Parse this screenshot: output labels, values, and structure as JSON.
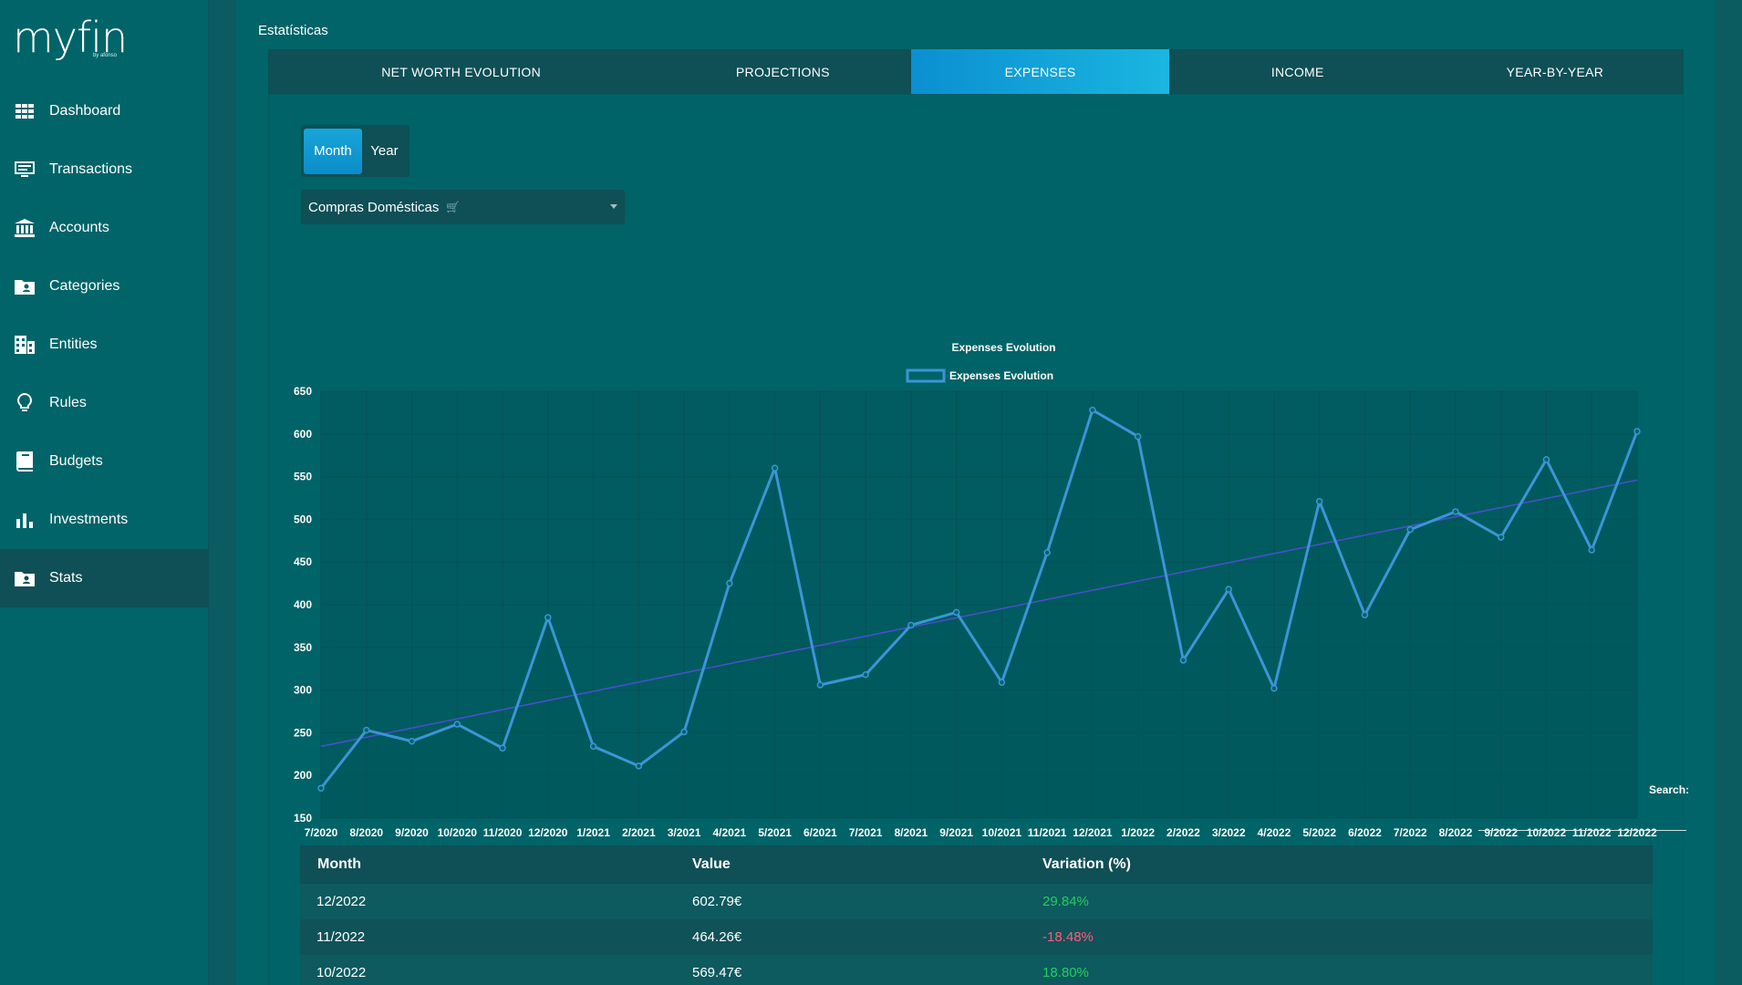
{
  "app": {
    "logo_text": "myfin",
    "logo_sub": "by afonso"
  },
  "sidebar": {
    "items": [
      {
        "label": "Dashboard",
        "icon": "grid-icon"
      },
      {
        "label": "Transactions",
        "icon": "monitor-icon"
      },
      {
        "label": "Accounts",
        "icon": "bank-icon"
      },
      {
        "label": "Categories",
        "icon": "folder-user-icon"
      },
      {
        "label": "Entities",
        "icon": "building-icon"
      },
      {
        "label": "Rules",
        "icon": "lightbulb-icon"
      },
      {
        "label": "Budgets",
        "icon": "book-icon"
      },
      {
        "label": "Investments",
        "icon": "bar-chart-icon"
      },
      {
        "label": "Stats",
        "icon": "folder-user-icon"
      }
    ],
    "active": "Stats"
  },
  "page": {
    "title": "Estatísticas"
  },
  "tabs": [
    "NET WORTH EVOLUTION",
    "PROJECTIONS",
    "EXPENSES",
    "INCOME",
    "YEAR-BY-YEAR"
  ],
  "active_tab": "EXPENSES",
  "toggle": {
    "month": "Month",
    "year": "Year",
    "selected": "Month"
  },
  "category_select": {
    "value": "Compras Domésticas",
    "emoji": "🛒"
  },
  "search": {
    "label": "Search:",
    "value": ""
  },
  "colors": {
    "accent": "#1ab6e0",
    "line": "#3b95d6",
    "trend": "#4a4fd0",
    "positive": "#22d05a",
    "negative": "#ff5c7a"
  },
  "chart_data": {
    "type": "line",
    "title": "Expenses Evolution",
    "legend": [
      "Expenses Evolution"
    ],
    "legend_position": "top",
    "grid": true,
    "ylim": [
      150,
      650
    ],
    "yticks": [
      150,
      200,
      250,
      300,
      350,
      400,
      450,
      500,
      550,
      600,
      650
    ],
    "categories": [
      "7/2020",
      "8/2020",
      "9/2020",
      "10/2020",
      "11/2020",
      "12/2020",
      "1/2021",
      "2/2021",
      "3/2021",
      "4/2021",
      "5/2021",
      "6/2021",
      "7/2021",
      "8/2021",
      "9/2021",
      "10/2021",
      "11/2021",
      "12/2021",
      "1/2022",
      "2/2022",
      "3/2022",
      "4/2022",
      "5/2022",
      "6/2022",
      "7/2022",
      "8/2022",
      "9/2022",
      "10/2022",
      "11/2022",
      "12/2022"
    ],
    "series": [
      {
        "name": "Expenses Evolution",
        "values": [
          185,
          253,
          240,
          260,
          232,
          385,
          234,
          211,
          251,
          425,
          560,
          306,
          318,
          376,
          391,
          309,
          461,
          628,
          597,
          335,
          418,
          302,
          521,
          388,
          488,
          509,
          479,
          570,
          464,
          603
        ]
      }
    ],
    "trendline": {
      "start": 234,
      "end": 546
    }
  },
  "table": {
    "headers": [
      "Month",
      "Value",
      "Variation (%)"
    ],
    "rows": [
      {
        "month": "12/2022",
        "value": "602.79€",
        "variation": "29.84%",
        "sign": "pos"
      },
      {
        "month": "11/2022",
        "value": "464.26€",
        "variation": "-18.48%",
        "sign": "neg"
      },
      {
        "month": "10/2022",
        "value": "569.47€",
        "variation": "18.80%",
        "sign": "pos"
      }
    ]
  }
}
